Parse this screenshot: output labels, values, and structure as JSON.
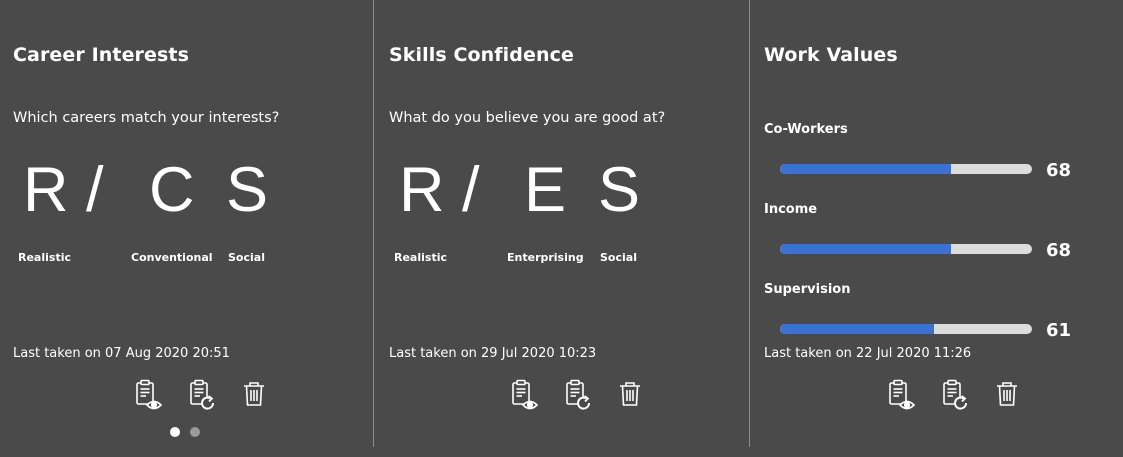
{
  "cards": [
    {
      "title": "Career Interests",
      "question": "Which careers match your interests?",
      "letters": [
        "R",
        "/",
        "C",
        "S"
      ],
      "labels": [
        "Realistic",
        "Conventional",
        "Social"
      ],
      "last_taken": "Last taken on 07 Aug 2020 20:51"
    },
    {
      "title": "Skills Confidence",
      "question": "What do you believe you are good at?",
      "letters": [
        "R",
        "/",
        "E",
        "S"
      ],
      "labels": [
        "Realistic",
        "Enterprising",
        "Social"
      ],
      "last_taken": "Last taken on 29 Jul 2020 10:23"
    },
    {
      "title": "Work Values",
      "values": [
        {
          "name": "Co-Workers",
          "score": "68",
          "fraction": 0.68
        },
        {
          "name": "Income",
          "score": "68",
          "fraction": 0.68
        },
        {
          "name": "Supervision",
          "score": "61",
          "fraction": 0.61
        }
      ],
      "last_taken": "Last taken on 22 Jul 2020 11:26"
    }
  ],
  "actions": {
    "view": "clipboard-view-icon",
    "retake": "clipboard-retake-icon",
    "delete": "trash-icon"
  },
  "pagination": {
    "active_index": 0,
    "count": 2
  },
  "colors": {
    "background": "#4a4a4a",
    "bar_fill": "#3a72d3",
    "bar_track": "#dcdcdc",
    "dot_active": "#ffffff",
    "dot_inactive": "#9a9a9a"
  }
}
